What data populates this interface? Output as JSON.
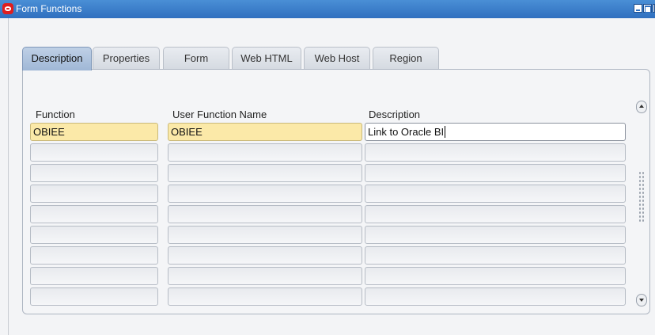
{
  "window": {
    "title": "Form Functions"
  },
  "tabs": [
    {
      "label": "Description",
      "active": true
    },
    {
      "label": "Properties",
      "active": false
    },
    {
      "label": "Form",
      "active": false
    },
    {
      "label": "Web HTML",
      "active": false
    },
    {
      "label": "Web Host",
      "active": false
    },
    {
      "label": "Region",
      "active": false
    }
  ],
  "columns": {
    "function": "Function",
    "user_function_name": "User Function Name",
    "description": "Description"
  },
  "rows": [
    {
      "function": "OBIEE",
      "user_function_name": "OBIEE",
      "description": "Link to Oracle BI"
    },
    {
      "function": "",
      "user_function_name": "",
      "description": ""
    },
    {
      "function": "",
      "user_function_name": "",
      "description": ""
    },
    {
      "function": "",
      "user_function_name": "",
      "description": ""
    },
    {
      "function": "",
      "user_function_name": "",
      "description": ""
    },
    {
      "function": "",
      "user_function_name": "",
      "description": ""
    },
    {
      "function": "",
      "user_function_name": "",
      "description": ""
    },
    {
      "function": "",
      "user_function_name": "",
      "description": ""
    },
    {
      "function": "",
      "user_function_name": "",
      "description": ""
    }
  ],
  "colors": {
    "titlebar": "#2f6fbf",
    "required_field": "#fbe9a8",
    "active_tab": "#9fb7d6"
  },
  "icons": {
    "logo": "oracle-logo-icon",
    "minimize": "minimize-icon",
    "maximize": "maximize-icon",
    "scroll_up": "scroll-up-arrow-icon",
    "scroll_down": "scroll-down-arrow-icon"
  }
}
